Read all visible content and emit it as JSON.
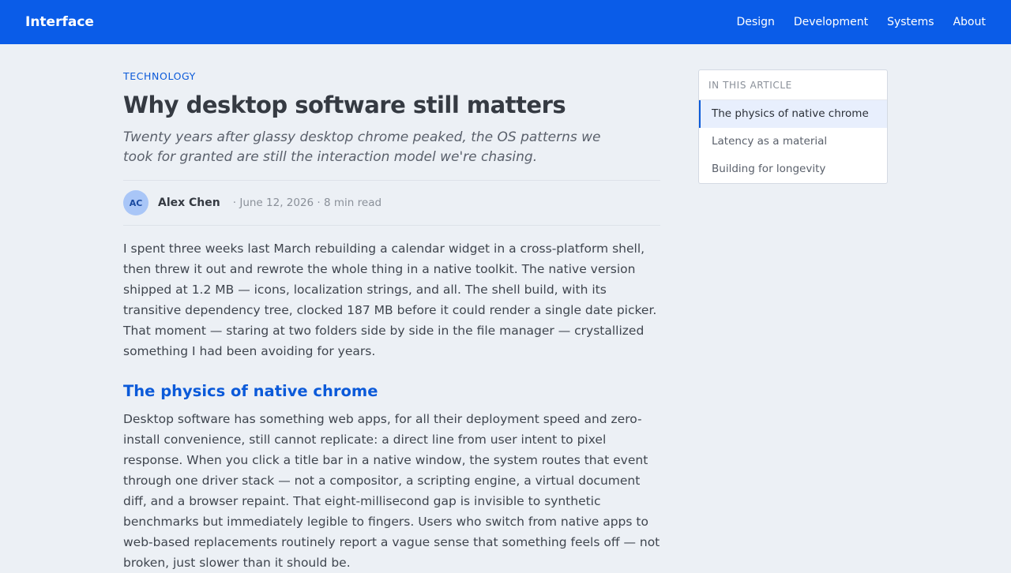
{
  "header": {
    "brand": "Interface",
    "nav": [
      "Design",
      "Development",
      "Systems",
      "About"
    ]
  },
  "article": {
    "category": "TECHNOLOGY",
    "title": "Why desktop software still matters",
    "subtitle": "Twenty years after glassy desktop chrome peaked, the OS patterns we took for granted are still the interaction model we're chasing.",
    "author_initials": "AC",
    "author": "Alex Chen",
    "meta": "· June 12, 2026 · 8 min read",
    "intro": "I spent three weeks last March rebuilding a calendar widget in a cross-platform shell, then threw it out and rewrote the whole thing in a native toolkit. The native version shipped at 1.2 MB — icons, localization strings, and all. The shell build, with its transitive dependency tree, clocked 187 MB before it could render a single date picker. That moment — staring at two folders side by side in the file manager — crystallized something I had been avoiding for years.",
    "section_heading": "The physics of native chrome",
    "section_body": "Desktop software has something web apps, for all their deployment speed and zero-install convenience, still cannot replicate: a direct line from user intent to pixel response. When you click a title bar in a native window, the system routes that event through one driver stack — not a compositor, a scripting engine, a virtual document diff, and a browser repaint. That eight-millisecond gap is invisible to synthetic benchmarks but immediately legible to fingers. Users who switch from native apps to web-based replacements routinely report a vague sense that something feels off — not broken, just slower than it should be."
  },
  "toc": {
    "heading": "IN THIS ARTICLE",
    "items": [
      "The physics of native chrome",
      "Latency as a material",
      "Building for longevity"
    ]
  },
  "colors": {
    "header_bg": "#0a5ce8",
    "page_bg": "#ecf0f5",
    "accent": "#0b5ad9"
  }
}
